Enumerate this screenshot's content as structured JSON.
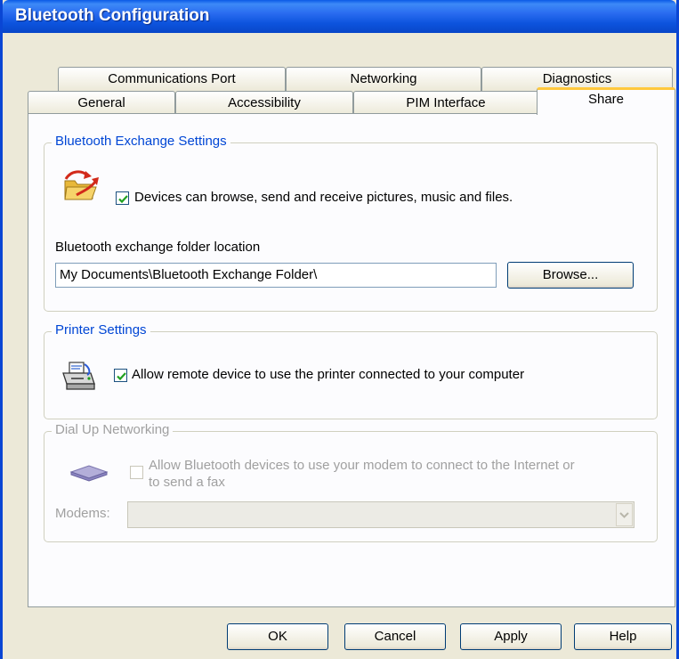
{
  "window": {
    "title": "Bluetooth Configuration"
  },
  "tabs": {
    "row1": [
      "Communications Port",
      "Networking",
      "Diagnostics"
    ],
    "row2": [
      "General",
      "Accessibility",
      "PIM Interface",
      "Share"
    ],
    "active": "Share"
  },
  "exchange": {
    "group_title": "Bluetooth Exchange Settings",
    "checkbox_label": "Devices can browse, send and receive pictures, music and files.",
    "checked": true,
    "folder_label": "Bluetooth exchange folder location",
    "folder_value": "My Documents\\Bluetooth Exchange Folder\\",
    "browse_label": "Browse..."
  },
  "printer": {
    "group_title": "Printer Settings",
    "checkbox_label": "Allow remote device to use the printer connected to your computer",
    "checked": true
  },
  "dialup": {
    "group_title": "Dial Up Networking",
    "checkbox_label_line1": "Allow Bluetooth devices to use your modem to connect to the Internet or",
    "checkbox_label_line2": "to send a fax",
    "checked": false,
    "modems_label": "Modems:",
    "modems_value": ""
  },
  "buttons": {
    "ok": "OK",
    "cancel": "Cancel",
    "apply": "Apply",
    "help": "Help"
  },
  "colors": {
    "titlebar": "#0a5ae6",
    "group_title": "#0046d5",
    "active_tab_accent": "#ffc83c",
    "dialog_bg": "#ece9d8"
  }
}
